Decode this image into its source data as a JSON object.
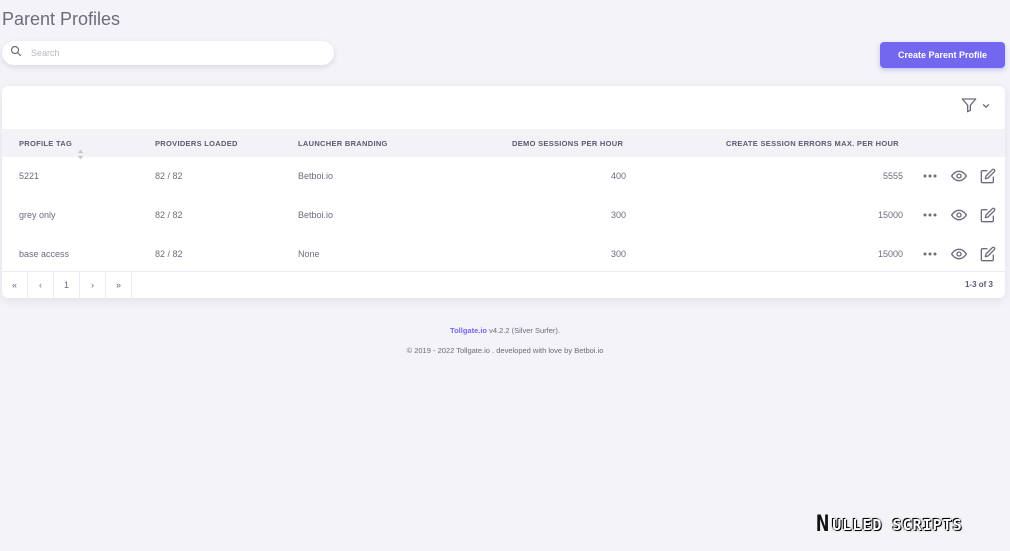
{
  "page": {
    "title": "Parent Profiles"
  },
  "search": {
    "placeholder": "Search"
  },
  "actions": {
    "create_label": "Create Parent Profile"
  },
  "colors": {
    "accent": "#7367f0",
    "background": "#f3f3f8"
  },
  "table": {
    "columns": [
      "PROFILE TAG",
      "PROVIDERS LOADED",
      "LAUNCHER BRANDING",
      "DEMO SESSIONS PER HOUR",
      "CREATE SESSION ERRORS MAX. PER HOUR"
    ],
    "rows": [
      {
        "tag": "5221",
        "providers": "82 / 82",
        "branding": "Betboi.io",
        "demo": "400",
        "errors": "5555"
      },
      {
        "tag": "grey only",
        "providers": "82 / 82",
        "branding": "Betboi.io",
        "demo": "300",
        "errors": "15000"
      },
      {
        "tag": "base access",
        "providers": "82 / 82",
        "branding": "None",
        "demo": "300",
        "errors": "15000"
      }
    ],
    "row_icons": [
      "more-horizontal-icon",
      "eye-icon",
      "edit-icon"
    ]
  },
  "pagination": {
    "first": "«",
    "prev": "‹",
    "current": "1",
    "next": "›",
    "last": "»",
    "info": "1-3 of 3"
  },
  "footer": {
    "brand": "Tollgate.io",
    "version": "v4.2.2 (Silver Surfer).",
    "copyright": "© 2019 - 2022 Tollgate.io . developed with love by Betboi.io"
  },
  "watermark": {
    "letter": "N",
    "text": "ULLED SCRIPTS"
  }
}
